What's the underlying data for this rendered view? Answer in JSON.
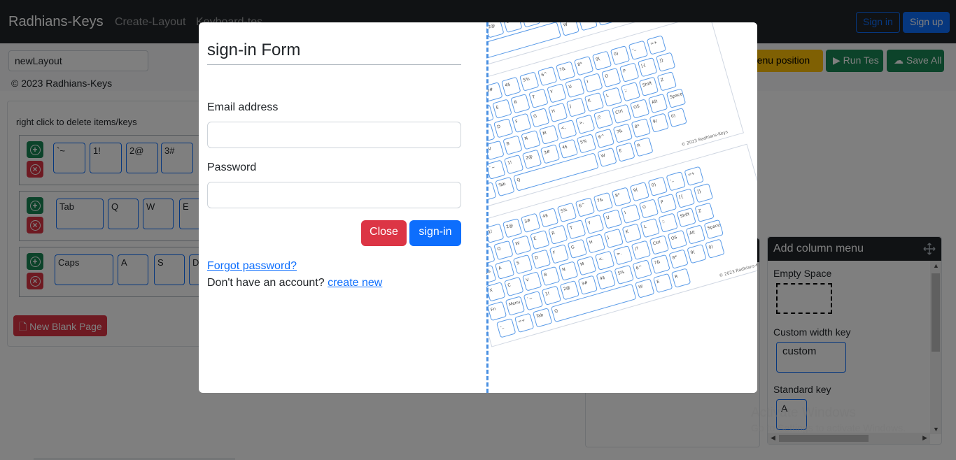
{
  "navbar": {
    "brand": "Radhians-Keys",
    "links": [
      "Create-Layout",
      "Keyboard-tes"
    ],
    "sign_in": "Sign in",
    "sign_up": "Sign up"
  },
  "toolbar": {
    "layout_name_value": "newLayout",
    "menu_position_label": "menu position",
    "run_test_label": "Run Tes",
    "save_all_label": "Save All"
  },
  "footer_copyright": "© 2023 Radhians-Keys",
  "editor": {
    "hint": "right click to delete items/keys",
    "rows": [
      {
        "keys": [
          "`~",
          "1!",
          "2@",
          "3#"
        ]
      },
      {
        "keys": [
          "Tab",
          "Q",
          "W",
          "E"
        ]
      },
      {
        "keys": [
          "Caps",
          "A",
          "S",
          "D"
        ]
      }
    ],
    "new_page_label": "New Blank Page"
  },
  "column_menu": {
    "title": "Add column menu",
    "empty_space_label": "Empty Space",
    "custom_width_label": "Custom width key",
    "custom_key_text": "custom",
    "standard_key_label": "Standard key",
    "standard_key_text": "A"
  },
  "watermark": {
    "line1": "Activate Windows",
    "line2": "Go to Settings to activate Windows."
  },
  "modal": {
    "title": "sign-in Form",
    "email_label": "Email address",
    "email_value": "",
    "password_label": "Password",
    "password_value": "",
    "close_label": "Close",
    "sign_in_label": "sign-in",
    "forgot_label": "Forgot password?",
    "no_account_text": "Don't have an account?",
    "create_new_label": "create new",
    "illustration_caption": "© 2023 Radhians-Keys"
  },
  "colors": {
    "navbar_bg": "#212529",
    "primary": "#0d6efd",
    "danger": "#dc3545",
    "success": "#198754",
    "warning": "#ffc107"
  },
  "icons": [
    "plus-circle-icon",
    "x-circle-icon",
    "file-icon",
    "play-icon",
    "cloud-upload-icon",
    "move-arrows-icon"
  ]
}
